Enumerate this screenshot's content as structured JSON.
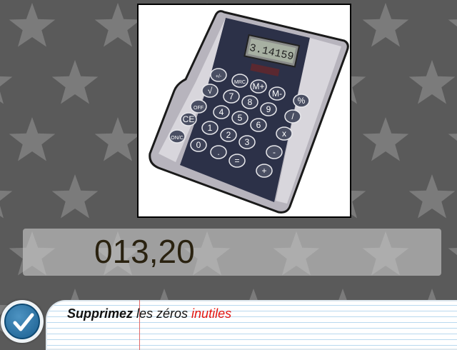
{
  "answer": {
    "value": "013,20"
  },
  "instruction": {
    "part1": "Supprimez",
    "part2": " les zéros ",
    "part3": "inutiles"
  },
  "calculator": {
    "display": "3.14159",
    "keys": [
      "+/-",
      "√",
      "OFF",
      "CE",
      "ON/C",
      "MRC",
      "M+",
      "M-",
      "%",
      "7",
      "8",
      "9",
      "/",
      "4",
      "5",
      "6",
      "x",
      "1",
      "2",
      "3",
      "-",
      "0",
      ".",
      "=",
      "+"
    ]
  },
  "icons": {
    "validate": "checkmark-icon",
    "background": "star-pattern"
  },
  "colors": {
    "background": "#5a5a5a",
    "star": "#7b7b7b",
    "highlight": "#e3140f",
    "button": "#1a5f90"
  }
}
